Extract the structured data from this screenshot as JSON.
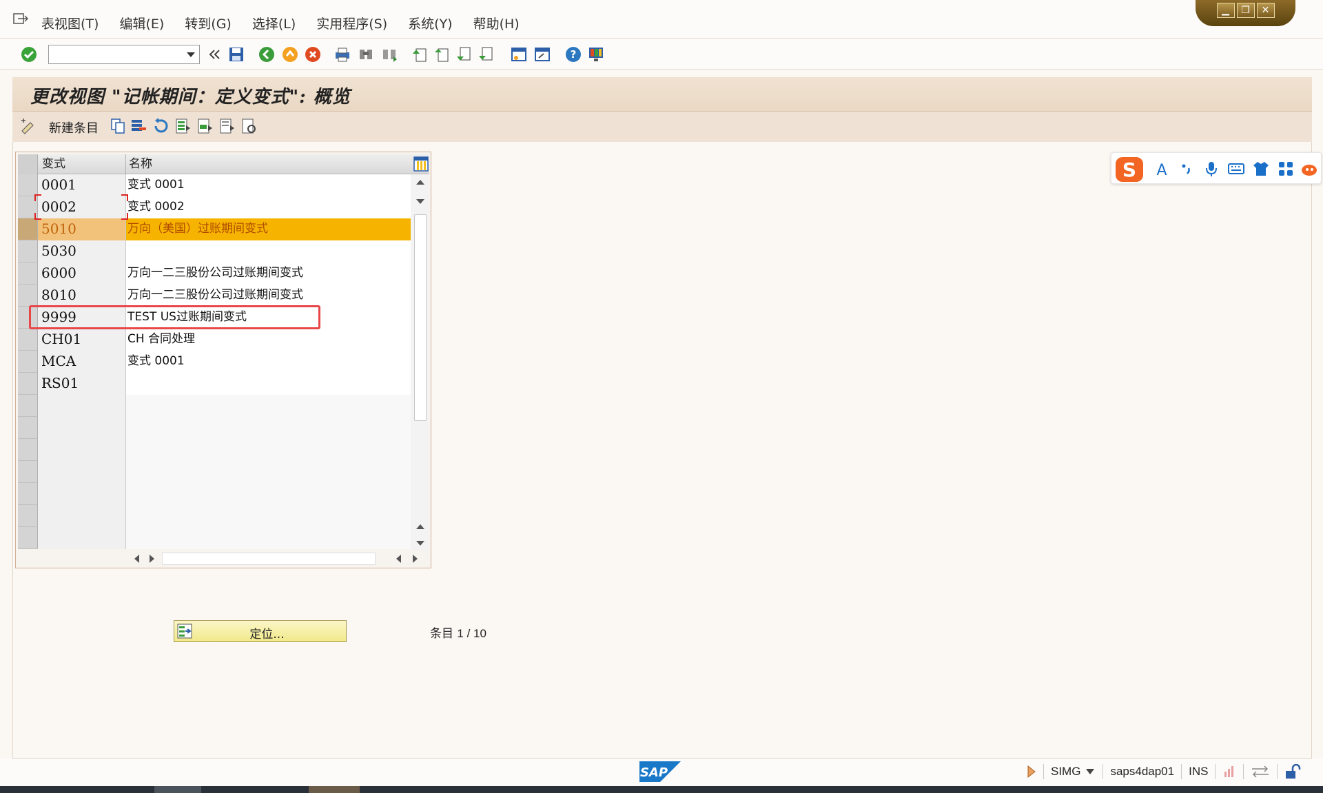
{
  "menu": {
    "items": [
      "表视图(T)",
      "编辑(E)",
      "转到(G)",
      "选择(L)",
      "实用程序(S)",
      "系统(Y)",
      "帮助(H)"
    ]
  },
  "window_controls": {
    "minimize": "▁",
    "restore": "❐",
    "close": "✕"
  },
  "toolbar": {
    "command_field_value": "",
    "icons": [
      "enter-check-icon",
      "command-dropdown-icon",
      "collapse-chevron-icon",
      "save-icon",
      "back-icon",
      "exit-icon",
      "cancel-icon",
      "print-icon",
      "find-icon",
      "find-next-icon",
      "first-page-icon",
      "previous-page-icon",
      "next-page-icon",
      "last-page-icon",
      "new-session-icon",
      "shortcut-icon",
      "help-icon",
      "customize-layout-icon"
    ]
  },
  "title": "更改视图 \"记帐期间：定义变式\": 概览",
  "app_toolbar": {
    "new_entries_label": "新建条目",
    "icons": [
      "display-change-icon",
      "copy-as-icon",
      "delete-icon",
      "undo-change-icon",
      "select-all-icon",
      "select-block-icon",
      "deselect-all-icon",
      "configure-icon"
    ]
  },
  "table": {
    "headers": {
      "col1": "变式",
      "col2": "名称"
    },
    "rows": [
      {
        "key": "0001",
        "name": "变式 0001"
      },
      {
        "key": "0002",
        "name": "变式 0002"
      },
      {
        "key": "5010",
        "name": "万向（美国）过账期间变式"
      },
      {
        "key": "5030",
        "name": ""
      },
      {
        "key": "6000",
        "name": "万向一二三股份公司过账期间变式"
      },
      {
        "key": "8010",
        "name": "万向一二三股份公司过账期间变式"
      },
      {
        "key": "9999",
        "name": "TEST US过账期间变式"
      },
      {
        "key": "CH01",
        "name": "CH 合同处理"
      },
      {
        "key": "MCA",
        "name": "变式 0001"
      },
      {
        "key": "RS01",
        "name": ""
      }
    ],
    "highlighted_row": "5010",
    "annotated_row": "9999"
  },
  "position_button": {
    "label": "定位..."
  },
  "entry_info": {
    "label": "条目",
    "value": "1 / 10"
  },
  "statusbar": {
    "transaction": "SIMG",
    "server": "saps4dap01",
    "mode": "INS"
  },
  "colors": {
    "highlight_row": "#f6b400",
    "annotation_red": "#e8474a",
    "title_band": "#ead8c4"
  }
}
